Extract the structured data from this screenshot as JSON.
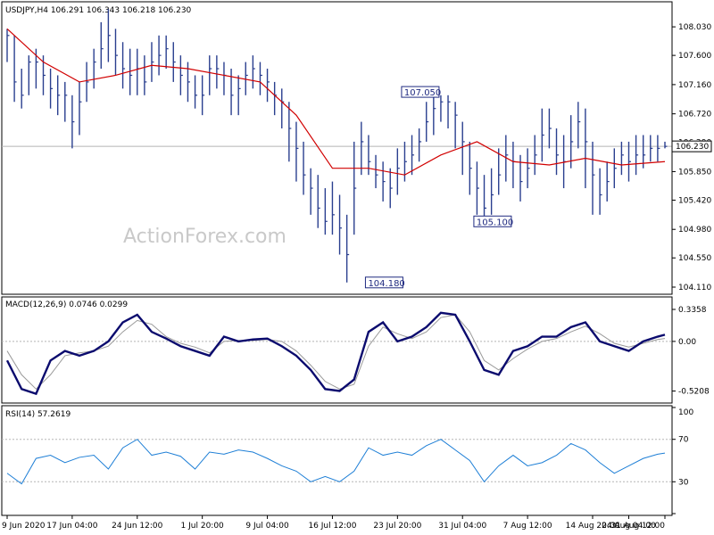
{
  "chart_data": {
    "type": "line",
    "watermark": "ActionForex.com",
    "price_panel": {
      "title": "USDJPY,H4  106.291 106.343 106.218 106.230",
      "ylim": [
        104.11,
        108.3
      ],
      "ticks": [
        "108.030",
        "107.600",
        "107.160",
        "106.720",
        "106.290",
        "105.850",
        "105.420",
        "104.980",
        "104.550",
        "104.110"
      ],
      "current": {
        "value": 106.23,
        "label": "106.230"
      },
      "annotations": [
        {
          "label": "107.050",
          "x": 60,
          "y": 107.05,
          "side": "left"
        },
        {
          "label": "105.100",
          "x": 70,
          "y": 105.1,
          "side": "left"
        },
        {
          "label": "104.180",
          "x": 55,
          "y": 104.18,
          "side": "left"
        }
      ],
      "series": [
        {
          "style": "hl-bars",
          "color": "#2a3f8f",
          "x": [
            0,
            1,
            2,
            3,
            4,
            5,
            6,
            7,
            8,
            9,
            10,
            11,
            12,
            13,
            14,
            15,
            16,
            17,
            18,
            19,
            20,
            21,
            22,
            23,
            24,
            25,
            26,
            27,
            28,
            29,
            30,
            31,
            32,
            33,
            34,
            35,
            36,
            37,
            38,
            39,
            40,
            41,
            42,
            43,
            44,
            45,
            46,
            47,
            48,
            49,
            50,
            51,
            52,
            53,
            54,
            55,
            56,
            57,
            58,
            59,
            60,
            61,
            62,
            63,
            64,
            65,
            66,
            67,
            68,
            69,
            70,
            71,
            72,
            73,
            74,
            75,
            76,
            77,
            78,
            79,
            80,
            81,
            82,
            83,
            84,
            85,
            86,
            87,
            88,
            89,
            90,
            91
          ],
          "close": [
            107.9,
            107.2,
            107.0,
            107.5,
            107.5,
            107.3,
            107.1,
            107.0,
            107.0,
            106.6,
            106.9,
            107.2,
            107.5,
            107.7,
            107.9,
            107.6,
            107.4,
            107.3,
            107.4,
            107.2,
            107.5,
            107.6,
            107.7,
            107.5,
            107.3,
            107.2,
            107.0,
            107.0,
            107.4,
            107.4,
            107.3,
            107.0,
            107.1,
            107.3,
            107.4,
            107.3,
            107.2,
            107.0,
            106.9,
            106.5,
            106.2,
            105.8,
            105.6,
            105.3,
            105.1,
            105.2,
            105.0,
            104.6,
            105.6,
            106.3,
            106.0,
            105.8,
            105.7,
            105.6,
            105.9,
            106.0,
            106.1,
            106.3,
            106.6,
            106.8,
            106.9,
            106.9,
            106.7,
            106.3,
            105.9,
            105.6,
            105.3,
            105.5,
            105.8,
            106.1,
            106.0,
            105.7,
            105.9,
            106.1,
            106.4,
            106.5,
            106.1,
            106.0,
            106.3,
            106.6,
            106.3,
            105.8,
            105.5,
            105.7,
            105.9,
            106.1,
            106.0,
            106.1,
            106.1,
            106.2,
            106.2,
            106.23
          ],
          "high": [
            108.0,
            107.9,
            107.4,
            107.6,
            107.7,
            107.6,
            107.4,
            107.3,
            107.2,
            107.0,
            107.2,
            107.5,
            107.7,
            108.1,
            108.3,
            108.0,
            107.8,
            107.7,
            107.7,
            107.6,
            107.8,
            107.9,
            107.9,
            107.8,
            107.6,
            107.5,
            107.3,
            107.3,
            107.6,
            107.6,
            107.5,
            107.4,
            107.3,
            107.5,
            107.6,
            107.5,
            107.4,
            107.2,
            107.1,
            106.9,
            106.6,
            106.3,
            105.9,
            105.8,
            105.6,
            105.7,
            105.5,
            105.2,
            106.3,
            106.6,
            106.4,
            106.1,
            106.0,
            105.9,
            106.2,
            106.3,
            106.4,
            106.5,
            106.9,
            107.05,
            107.0,
            107.0,
            106.9,
            106.6,
            106.3,
            106.0,
            105.8,
            105.9,
            106.2,
            106.4,
            106.3,
            106.1,
            106.2,
            106.4,
            106.8,
            106.8,
            106.5,
            106.4,
            106.7,
            106.9,
            106.8,
            106.3,
            105.9,
            106.0,
            106.2,
            106.3,
            106.3,
            106.4,
            106.4,
            106.4,
            106.4,
            106.3
          ],
          "low": [
            107.5,
            106.9,
            106.8,
            107.0,
            107.1,
            107.0,
            106.8,
            106.7,
            106.6,
            106.2,
            106.4,
            106.9,
            107.1,
            107.4,
            107.5,
            107.3,
            107.1,
            107.0,
            107.0,
            107.0,
            107.2,
            107.3,
            107.4,
            107.2,
            107.0,
            106.9,
            106.8,
            106.7,
            107.0,
            107.1,
            107.0,
            106.7,
            106.7,
            107.0,
            107.1,
            107.0,
            106.9,
            106.7,
            106.5,
            106.0,
            105.7,
            105.5,
            105.2,
            105.0,
            104.9,
            104.9,
            104.6,
            104.18,
            104.9,
            105.8,
            105.8,
            105.6,
            105.4,
            105.3,
            105.5,
            105.7,
            105.8,
            106.0,
            106.3,
            106.4,
            106.6,
            106.5,
            106.2,
            105.8,
            105.5,
            105.2,
            105.1,
            105.2,
            105.5,
            105.7,
            105.6,
            105.4,
            105.6,
            105.8,
            106.0,
            106.2,
            105.8,
            105.6,
            105.9,
            106.2,
            105.6,
            105.2,
            105.2,
            105.4,
            105.6,
            105.8,
            105.7,
            105.8,
            105.9,
            106.0,
            106.0,
            106.2
          ]
        },
        {
          "style": "line",
          "color": "#d10000",
          "x": [
            0,
            5,
            10,
            15,
            20,
            25,
            30,
            35,
            40,
            45,
            50,
            55,
            60,
            65,
            70,
            75,
            80,
            85,
            91
          ],
          "values": [
            108.0,
            107.5,
            107.2,
            107.3,
            107.45,
            107.4,
            107.3,
            107.2,
            106.7,
            105.9,
            105.9,
            105.8,
            106.1,
            106.3,
            106.0,
            105.95,
            106.05,
            105.95,
            106.0
          ]
        }
      ]
    },
    "macd_panel": {
      "title": "MACD(12,26,9) 0.0746 0.0299",
      "ylim": [
        -0.6,
        0.42
      ],
      "ticks": [
        "0.3358",
        "0.00",
        "-0.5208"
      ],
      "series": [
        {
          "style": "thick",
          "color": "#0b0b6e",
          "x": [
            0,
            2,
            4,
            6,
            8,
            10,
            12,
            14,
            16,
            18,
            20,
            22,
            24,
            26,
            28,
            30,
            32,
            34,
            36,
            38,
            40,
            42,
            44,
            46,
            48,
            50,
            52,
            54,
            56,
            58,
            60,
            62,
            64,
            66,
            68,
            70,
            72,
            74,
            76,
            78,
            80,
            82,
            84,
            86,
            88,
            90,
            91
          ],
          "values": [
            -0.2,
            -0.5,
            -0.55,
            -0.2,
            -0.1,
            -0.15,
            -0.1,
            0.0,
            0.2,
            0.28,
            0.1,
            0.03,
            -0.05,
            -0.1,
            -0.15,
            0.05,
            0.0,
            0.02,
            0.03,
            -0.05,
            -0.15,
            -0.3,
            -0.5,
            -0.52,
            -0.4,
            0.1,
            0.2,
            0.0,
            0.05,
            0.15,
            0.3,
            0.28,
            0.0,
            -0.3,
            -0.35,
            -0.1,
            -0.05,
            0.05,
            0.05,
            0.15,
            0.2,
            0.0,
            -0.05,
            -0.1,
            0.0,
            0.05,
            0.07
          ]
        },
        {
          "style": "line",
          "color": "#9a9a9a",
          "x": [
            0,
            2,
            4,
            6,
            8,
            10,
            12,
            14,
            16,
            18,
            20,
            22,
            24,
            26,
            28,
            30,
            32,
            34,
            36,
            38,
            40,
            42,
            44,
            46,
            48,
            50,
            52,
            54,
            56,
            58,
            60,
            62,
            64,
            66,
            68,
            70,
            72,
            74,
            76,
            78,
            80,
            82,
            84,
            86,
            88,
            90,
            91
          ],
          "values": [
            -0.1,
            -0.35,
            -0.5,
            -0.35,
            -0.15,
            -0.12,
            -0.1,
            -0.05,
            0.1,
            0.22,
            0.18,
            0.05,
            -0.02,
            -0.06,
            -0.12,
            0.0,
            0.01,
            0.01,
            0.02,
            0.0,
            -0.1,
            -0.25,
            -0.42,
            -0.5,
            -0.45,
            -0.05,
            0.15,
            0.08,
            0.03,
            0.1,
            0.25,
            0.28,
            0.1,
            -0.2,
            -0.3,
            -0.18,
            -0.08,
            0.0,
            0.03,
            0.1,
            0.16,
            0.08,
            -0.02,
            -0.06,
            -0.02,
            0.02,
            0.03
          ]
        }
      ]
    },
    "rsi_panel": {
      "title": "RSI(14) 57.2619",
      "ylim": [
        0,
        100
      ],
      "ticks": [
        "100",
        "70",
        "30",
        "0"
      ],
      "levels": [
        70,
        30
      ],
      "series": [
        {
          "style": "line",
          "color": "#1e7fd6",
          "x": [
            0,
            2,
            4,
            6,
            8,
            10,
            12,
            14,
            16,
            18,
            20,
            22,
            24,
            26,
            28,
            30,
            32,
            34,
            36,
            38,
            40,
            42,
            44,
            46,
            48,
            50,
            52,
            54,
            56,
            58,
            60,
            62,
            64,
            66,
            68,
            70,
            72,
            74,
            76,
            78,
            80,
            82,
            84,
            86,
            88,
            90,
            91
          ],
          "values": [
            38,
            28,
            52,
            55,
            48,
            53,
            55,
            42,
            62,
            70,
            55,
            58,
            54,
            42,
            58,
            56,
            60,
            58,
            52,
            45,
            40,
            30,
            35,
            30,
            40,
            62,
            55,
            58,
            55,
            64,
            70,
            60,
            50,
            30,
            45,
            55,
            45,
            48,
            55,
            66,
            60,
            48,
            38,
            45,
            52,
            56,
            57
          ]
        }
      ]
    },
    "x_axis": {
      "count": 92,
      "ticks": [
        {
          "x": 0,
          "label": "9 Jun 2020"
        },
        {
          "x": 9,
          "label": "17 Jun 04:00"
        },
        {
          "x": 18,
          "label": "24 Jun 12:00"
        },
        {
          "x": 27,
          "label": "1 Jul 20:00"
        },
        {
          "x": 36,
          "label": "9 Jul 04:00"
        },
        {
          "x": 45,
          "label": "16 Jul 12:00"
        },
        {
          "x": 54,
          "label": "23 Jul 20:00"
        },
        {
          "x": 63,
          "label": "31 Jul 04:00"
        },
        {
          "x": 72,
          "label": "7 Aug 12:00"
        },
        {
          "x": 81,
          "label": "14 Aug 20:00"
        },
        {
          "x": 86,
          "label": "24 Aug 04:00"
        },
        {
          "x": 91,
          "label": "31 Aug 12:00"
        }
      ]
    }
  }
}
